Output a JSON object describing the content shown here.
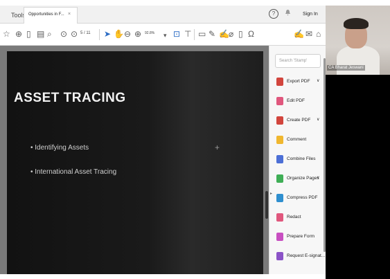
{
  "tabbar": {
    "tools_label": "Tools",
    "doc_tab_label": "Opportunities in F...",
    "close_glyph": "×",
    "help_glyph": "?",
    "bell_glyph": "🔔",
    "signin_label": "Sign In"
  },
  "toolbar": {
    "page_indicator": "5 / 11",
    "zoom_level": "92.8%",
    "icons": [
      "star-icon",
      "upload-icon",
      "page-add-icon",
      "print-icon",
      "zoom-out-icon",
      "page-up-icon",
      "page-down-icon",
      "pointer-icon",
      "hand-icon",
      "zoom-minus-icon",
      "zoom-plus-icon",
      "fit-page-icon",
      "scroll-mode-icon",
      "comment-icon",
      "pen-icon",
      "sign-icon",
      "fill-icon",
      "delete-icon",
      "audio-icon",
      "sign-right-icon",
      "mail-icon",
      "share-icon"
    ]
  },
  "slide": {
    "title": "ASSET TRACING",
    "bullets": [
      "• Identifying Assets",
      "• International Asset Tracing"
    ]
  },
  "rightpane": {
    "search_placeholder": "Search 'Stamp'",
    "items": [
      {
        "label": "Export PDF",
        "chev": "∨",
        "color": "#d2453d"
      },
      {
        "label": "Edit PDF",
        "chev": "",
        "color": "#e0577d"
      },
      {
        "label": "Create PDF",
        "chev": "∨",
        "color": "#d2453d"
      },
      {
        "label": "Comment",
        "chev": "",
        "color": "#f0b72f"
      },
      {
        "label": "Combine Files",
        "chev": "",
        "color": "#4c6fd6"
      },
      {
        "label": "Organize Pages",
        "chev": "∨",
        "color": "#3fae56"
      },
      {
        "label": "Compress PDF",
        "chev": "",
        "color": "#2f8fcf"
      },
      {
        "label": "Redact",
        "chev": "",
        "color": "#e0577d"
      },
      {
        "label": "Prepare Form",
        "chev": "",
        "color": "#c84fc1"
      },
      {
        "label": "Request E-signat...",
        "chev": "",
        "color": "#8b53c7"
      }
    ]
  },
  "video": {
    "participant_name": "CA Bharat Jeswani"
  }
}
